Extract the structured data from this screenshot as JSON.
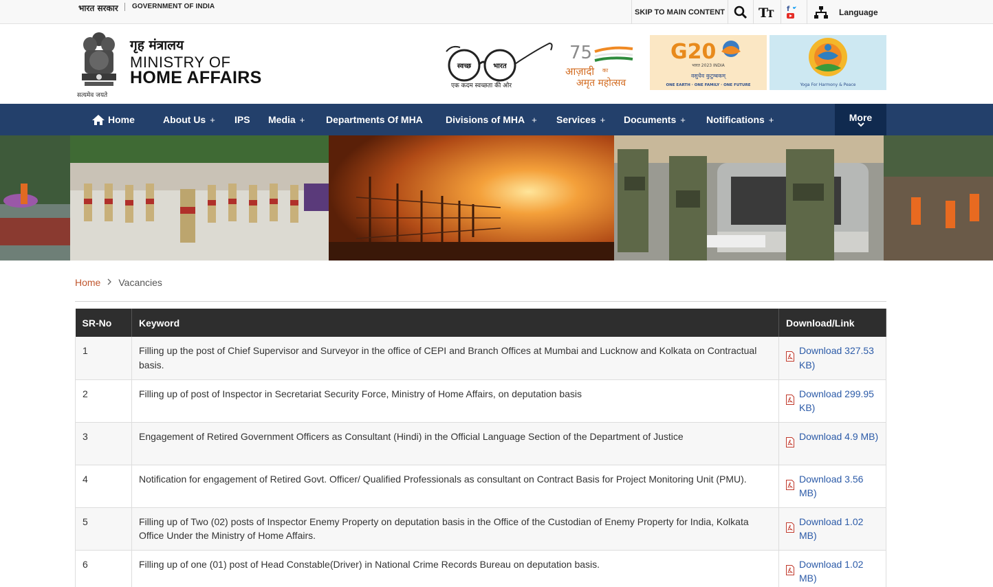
{
  "topbar": {
    "gov_hindi": "भारत सरकार",
    "gov_english": "GOVERNMENT OF INDIA",
    "skip_label": "SKIP TO MAIN CONTENT",
    "language_label": "Language"
  },
  "header": {
    "emblem_caption": "सत्यमेव जयते",
    "ministry_hindi": "गृह मंत्रालय",
    "ministry_line1": "MINISTRY OF",
    "ministry_line2": "HOME AFFAIRS",
    "swachh_left": "स्वच्छ",
    "swachh_right": "भारत",
    "swachh_tagline": "एक कदम स्वच्छता की ओर",
    "azadi_75": "75",
    "azadi_line1": "आज़ादी",
    "azadi_ka": "का",
    "azadi_line2": "अमृत महोत्सव",
    "g20_title": "G20",
    "g20_sub": "भारत 2023 INDIA",
    "g20_hindi": "वसुधैव कुटुम्बकम्",
    "g20_tagline": "ONE EARTH · ONE FAMILY · ONE FUTURE",
    "yoga_tagline": "Yoga For Harmony & Peace"
  },
  "nav": {
    "items": [
      {
        "label": "Home",
        "plus": ""
      },
      {
        "label": "About Us",
        "plus": "+"
      },
      {
        "label": "IPS",
        "plus": ""
      },
      {
        "label": "Media",
        "plus": "+"
      },
      {
        "label": "Departments Of MHA",
        "plus": ""
      },
      {
        "label": "Divisions of MHA",
        "plus": "+"
      },
      {
        "label": "Services",
        "plus": "+"
      },
      {
        "label": "Documents",
        "plus": "+"
      },
      {
        "label": "Notifications",
        "plus": "+"
      }
    ],
    "more_label": "More"
  },
  "breadcrumb": {
    "home": "Home",
    "current": "Vacancies"
  },
  "table": {
    "headers": [
      "SR-No",
      "Keyword",
      "Download/Link"
    ],
    "rows": [
      {
        "sr": "1",
        "keyword": "Filling up the post of Chief Supervisor and Surveyor in the office of CEPI and Branch Offices at Mumbai and Lucknow and Kolkata on Contractual basis.",
        "download": "Download 327.53 KB)"
      },
      {
        "sr": "2",
        "keyword": "Filling up of post of Inspector in Secretariat Security Force, Ministry of Home Affairs, on deputation basis",
        "download": "Download 299.95 KB)"
      },
      {
        "sr": "3",
        "keyword": "Engagement of Retired Government Officers as Consultant (Hindi) in the Official Language Section of the Department of Justice",
        "download": "Download 4.9 MB)"
      },
      {
        "sr": "4",
        "keyword": "Notification for engagement of Retired Govt. Officer/ Qualified Professionals as consultant on Contract Basis for Project Monitoring Unit (PMU).",
        "download": "Download 3.56 MB)"
      },
      {
        "sr": "5",
        "keyword": "Filling up of Two (02) posts of Inspector Enemy Property on deputation basis in the Office of the Custodian of Enemy Property for India, Kolkata Office Under the Ministry of Home Affairs.",
        "download": "Download 1.02 MB)"
      },
      {
        "sr": "6",
        "keyword": "Filling up of one (01) post of Head Constable(Driver) in National Crime Records Bureau on deputation basis.",
        "download": "Download 1.02 MB)"
      }
    ]
  },
  "colors": {
    "nav_bg": "#23406b",
    "nav_more_bg": "#102a4f",
    "table_header_bg": "#2e2e2e",
    "link": "#2c5ba8",
    "breadcrumb_home": "#c0562e"
  }
}
